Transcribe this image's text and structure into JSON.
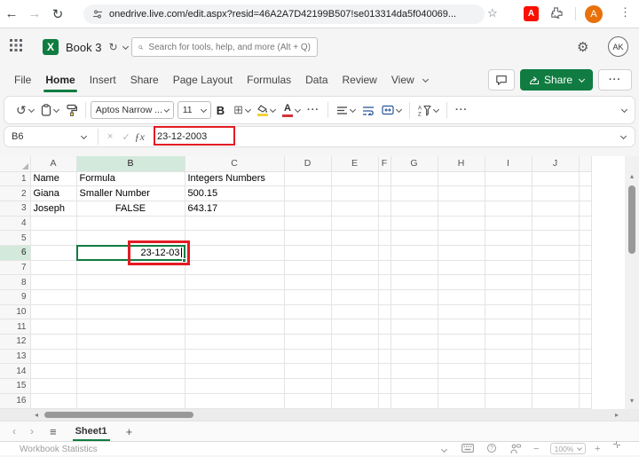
{
  "browser": {
    "url": "onedrive.live.com/edit.aspx?resid=46A2A7D42199B507!se013314da5f040069...",
    "icons": {
      "back": "←",
      "forward": "→",
      "reload": "↻",
      "star": "☆",
      "menu_dots": "⋮"
    },
    "profile_initial": "A",
    "adobe_label": "A"
  },
  "app_header": {
    "title": "Book 3",
    "sync_icon": "↻",
    "search_placeholder": "Search for tools, help, and more (Alt + Q)",
    "gear_icon": "⚙",
    "avatar": "AK"
  },
  "menu": {
    "items": [
      {
        "label": "File",
        "active": false
      },
      {
        "label": "Home",
        "active": true
      },
      {
        "label": "Insert",
        "active": false
      },
      {
        "label": "Share",
        "active": false
      },
      {
        "label": "Page Layout",
        "active": false
      },
      {
        "label": "Formulas",
        "active": false
      },
      {
        "label": "Data",
        "active": false
      },
      {
        "label": "Review",
        "active": false
      },
      {
        "label": "View",
        "active": false
      }
    ],
    "share_button_label": "Share"
  },
  "toolbar": {
    "undo_icon": "↺",
    "font_name": "Aptos Narrow ...",
    "font_size": "11",
    "bold_label": "B",
    "borders_icon": "⊞",
    "font_color_letter": "A",
    "more_dots": "···"
  },
  "formula_bar": {
    "name_box": "B6",
    "cancel_icon": "×",
    "enter_icon": "✓",
    "fx_label": "ƒx",
    "formula": "23-12-2003"
  },
  "grid": {
    "columns": [
      "A",
      "B",
      "C",
      "D",
      "E",
      "F",
      "G",
      "H",
      "I",
      "J"
    ],
    "row_numbers": [
      1,
      2,
      3,
      4,
      5,
      6,
      7,
      8,
      9,
      10,
      11,
      12,
      13,
      14,
      15,
      16
    ],
    "selected_column": "B",
    "selected_row": 6,
    "active_cell": "B6",
    "cells": {
      "A1": {
        "v": "Name",
        "bold": true,
        "bk": true
      },
      "B1": {
        "v": "Formula",
        "bold": true,
        "bk": true
      },
      "C1": {
        "v": "Integers Numbers",
        "bold": true,
        "bk": true
      },
      "A2": {
        "v": "Giana",
        "bk": true
      },
      "B2": {
        "v": "Smaller Number",
        "bk": true
      },
      "C2": {
        "v": "500.15",
        "bk": true
      },
      "A3": {
        "v": "Joseph",
        "bk": true
      },
      "B3": {
        "v": "FALSE",
        "align": "center",
        "bk": true
      },
      "C3": {
        "v": "643.17",
        "bk": true
      }
    },
    "active_cell_display": "23-12-03"
  },
  "scrollbars": {
    "up": "▴",
    "down": "▾",
    "left": "◂",
    "right": "▸"
  },
  "sheet_bar": {
    "prev_icon": "‹",
    "next_icon": "›",
    "all_sheets_icon": "≡",
    "sheet_name": "Sheet1",
    "add_icon": "+"
  },
  "status_bar": {
    "left_text": "Workbook Statistics",
    "zoom_level": "100%",
    "minus": "−",
    "plus": "+",
    "help": "?"
  }
}
